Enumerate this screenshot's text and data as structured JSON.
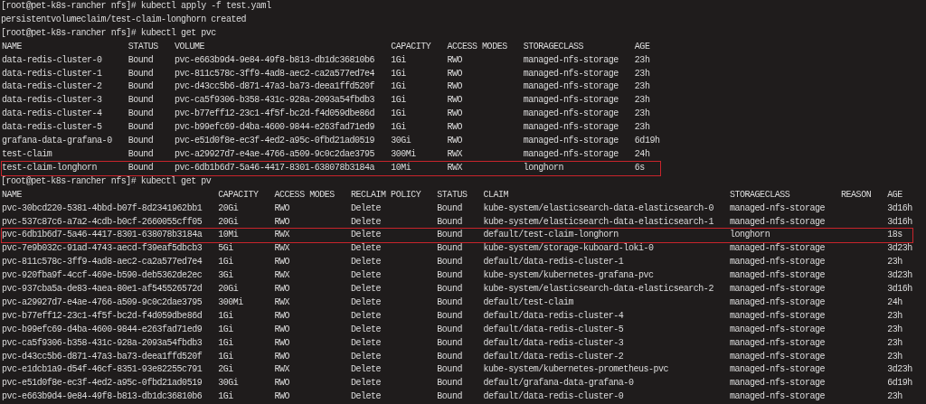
{
  "terminal": {
    "blocks": [
      {
        "kind": "command",
        "text": "[root@pet-k8s-rancher nfs]# kubectl apply -f test.yaml"
      },
      {
        "kind": "output",
        "text": "persistentvolumeclaim/test-claim-longhorn created"
      },
      {
        "kind": "command",
        "text": "[root@pet-k8s-rancher nfs]# kubectl get pvc"
      },
      {
        "kind": "table",
        "columns": [
          "NAME",
          "STATUS",
          "VOLUME",
          "CAPACITY",
          "ACCESS MODES",
          "STORAGECLASS",
          "AGE"
        ],
        "rows": [
          {
            "highlighted": false,
            "cells": [
              "data-redis-cluster-0",
              "Bound",
              "pvc-e663b9d4-9e84-49f8-b813-db1dc36810b6",
              "1Gi",
              "RWO",
              "managed-nfs-storage",
              "23h"
            ]
          },
          {
            "highlighted": false,
            "cells": [
              "data-redis-cluster-1",
              "Bound",
              "pvc-811c578c-3ff9-4ad8-aec2-ca2a577ed7e4",
              "1Gi",
              "RWO",
              "managed-nfs-storage",
              "23h"
            ]
          },
          {
            "highlighted": false,
            "cells": [
              "data-redis-cluster-2",
              "Bound",
              "pvc-d43cc5b6-d871-47a3-ba73-deea1ffd520f",
              "1Gi",
              "RWO",
              "managed-nfs-storage",
              "23h"
            ]
          },
          {
            "highlighted": false,
            "cells": [
              "data-redis-cluster-3",
              "Bound",
              "pvc-ca5f9306-b358-431c-928a-2093a54fbdb3",
              "1Gi",
              "RWO",
              "managed-nfs-storage",
              "23h"
            ]
          },
          {
            "highlighted": false,
            "cells": [
              "data-redis-cluster-4",
              "Bound",
              "pvc-b77eff12-23c1-4f5f-bc2d-f4d059dbe86d",
              "1Gi",
              "RWO",
              "managed-nfs-storage",
              "23h"
            ]
          },
          {
            "highlighted": false,
            "cells": [
              "data-redis-cluster-5",
              "Bound",
              "pvc-b99efc69-d4ba-4600-9844-e263fad71ed9",
              "1Gi",
              "RWO",
              "managed-nfs-storage",
              "23h"
            ]
          },
          {
            "highlighted": false,
            "cells": [
              "grafana-data-grafana-0",
              "Bound",
              "pvc-e51d0f8e-ec3f-4ed2-a95c-0fbd21ad0519",
              "30Gi",
              "RWO",
              "managed-nfs-storage",
              "6d19h"
            ]
          },
          {
            "highlighted": false,
            "cells": [
              "test-claim",
              "Bound",
              "pvc-a29927d7-e4ae-4766-a509-9c0c2dae3795",
              "300Mi",
              "RWX",
              "managed-nfs-storage",
              "24h"
            ]
          },
          {
            "highlighted": true,
            "cells": [
              "test-claim-longhorn",
              "Bound",
              "pvc-6db1b6d7-5a46-4417-8301-638078b3184a",
              "10Mi",
              "RWX",
              "longhorn",
              "6s"
            ]
          }
        ]
      },
      {
        "kind": "command",
        "text": "[root@pet-k8s-rancher nfs]# kubectl get pv"
      },
      {
        "kind": "table",
        "columns": [
          "NAME",
          "CAPACITY",
          "ACCESS MODES",
          "RECLAIM POLICY",
          "STATUS",
          "CLAIM",
          "STORAGECLASS",
          "REASON",
          "AGE"
        ],
        "rows": [
          {
            "highlighted": false,
            "cells": [
              "pvc-30bcd220-5381-4bbd-b07f-8d2341962bb1",
              "20Gi",
              "RWO",
              "Delete",
              "Bound",
              "kube-system/elasticsearch-data-elasticsearch-0",
              "managed-nfs-storage",
              null,
              "3d16h"
            ]
          },
          {
            "highlighted": false,
            "cells": [
              "pvc-537c87c6-a7a2-4cdb-b0cf-2660055cff05",
              "20Gi",
              "RWO",
              "Delete",
              "Bound",
              "kube-system/elasticsearch-data-elasticsearch-1",
              "managed-nfs-storage",
              null,
              "3d16h"
            ]
          },
          {
            "highlighted": true,
            "cells": [
              "pvc-6db1b6d7-5a46-4417-8301-638078b3184a",
              "10Mi",
              "RWX",
              "Delete",
              "Bound",
              "default/test-claim-longhorn",
              "longhorn",
              null,
              "18s"
            ]
          },
          {
            "highlighted": false,
            "cells": [
              "pvc-7e9b032c-91ad-4743-aecd-f39eaf5dbcb3",
              "5Gi",
              "RWX",
              "Delete",
              "Bound",
              "kube-system/storage-kuboard-loki-0",
              "managed-nfs-storage",
              null,
              "3d23h"
            ]
          },
          {
            "highlighted": false,
            "cells": [
              "pvc-811c578c-3ff9-4ad8-aec2-ca2a577ed7e4",
              "1Gi",
              "RWO",
              "Delete",
              "Bound",
              "default/data-redis-cluster-1",
              "managed-nfs-storage",
              null,
              "23h"
            ]
          },
          {
            "highlighted": false,
            "cells": [
              "pvc-920fba9f-4ccf-469e-b590-deb5362de2ec",
              "3Gi",
              "RWX",
              "Delete",
              "Bound",
              "kube-system/kubernetes-grafana-pvc",
              "managed-nfs-storage",
              null,
              "3d23h"
            ]
          },
          {
            "highlighted": false,
            "cells": [
              "pvc-937cba5a-de83-4aea-80e1-af545526572d",
              "20Gi",
              "RWO",
              "Delete",
              "Bound",
              "kube-system/elasticsearch-data-elasticsearch-2",
              "managed-nfs-storage",
              null,
              "3d16h"
            ]
          },
          {
            "highlighted": false,
            "cells": [
              "pvc-a29927d7-e4ae-4766-a509-9c0c2dae3795",
              "300Mi",
              "RWX",
              "Delete",
              "Bound",
              "default/test-claim",
              "managed-nfs-storage",
              null,
              "24h"
            ]
          },
          {
            "highlighted": false,
            "cells": [
              "pvc-b77eff12-23c1-4f5f-bc2d-f4d059dbe86d",
              "1Gi",
              "RWO",
              "Delete",
              "Bound",
              "default/data-redis-cluster-4",
              "managed-nfs-storage",
              null,
              "23h"
            ]
          },
          {
            "highlighted": false,
            "cells": [
              "pvc-b99efc69-d4ba-4600-9844-e263fad71ed9",
              "1Gi",
              "RWO",
              "Delete",
              "Bound",
              "default/data-redis-cluster-5",
              "managed-nfs-storage",
              null,
              "23h"
            ]
          },
          {
            "highlighted": false,
            "cells": [
              "pvc-ca5f9306-b358-431c-928a-2093a54fbdb3",
              "1Gi",
              "RWO",
              "Delete",
              "Bound",
              "default/data-redis-cluster-3",
              "managed-nfs-storage",
              null,
              "23h"
            ]
          },
          {
            "highlighted": false,
            "cells": [
              "pvc-d43cc5b6-d871-47a3-ba73-deea1ffd520f",
              "1Gi",
              "RWO",
              "Delete",
              "Bound",
              "default/data-redis-cluster-2",
              "managed-nfs-storage",
              null,
              "23h"
            ]
          },
          {
            "highlighted": false,
            "cells": [
              "pvc-e1dcb1a9-d54f-46cf-8351-93e82255c791",
              "2Gi",
              "RWX",
              "Delete",
              "Bound",
              "kube-system/kubernetes-prometheus-pvc",
              "managed-nfs-storage",
              null,
              "3d23h"
            ]
          },
          {
            "highlighted": false,
            "cells": [
              "pvc-e51d0f8e-ec3f-4ed2-a95c-0fbd21ad0519",
              "30Gi",
              "RWO",
              "Delete",
              "Bound",
              "default/grafana-data-grafana-0",
              "managed-nfs-storage",
              null,
              "6d19h"
            ]
          },
          {
            "highlighted": false,
            "cells": [
              "pvc-e663b9d4-9e84-49f8-b813-db1dc36810b6",
              "1Gi",
              "RWO",
              "Delete",
              "Bound",
              "default/data-redis-cluster-0",
              "managed-nfs-storage",
              null,
              "23h"
            ]
          }
        ]
      }
    ]
  }
}
